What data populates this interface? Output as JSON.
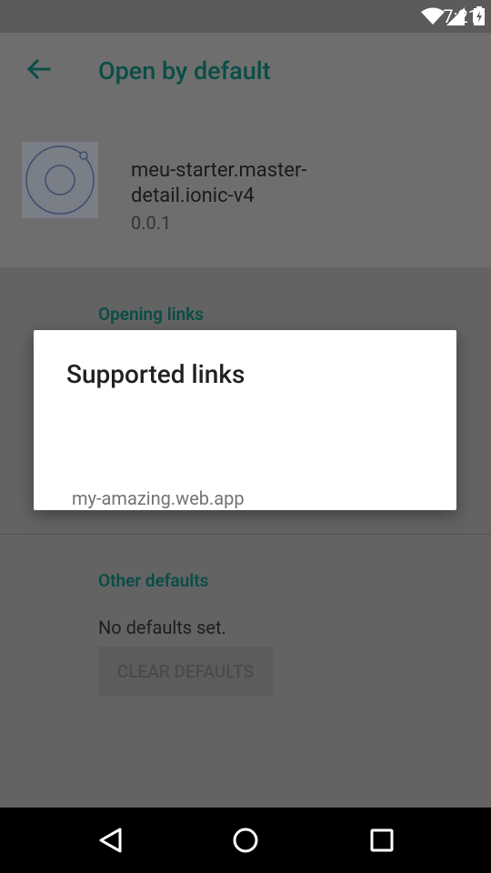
{
  "status_bar": {
    "time": "7:21"
  },
  "app_bar": {
    "title": "Open by default"
  },
  "app": {
    "name": "meu-starter.master-detail.ionic-v4",
    "version": "0.0.1"
  },
  "sections": {
    "opening_links": "Opening links",
    "other_defaults": "Other defaults",
    "no_defaults": "No defaults set.",
    "clear_defaults": "CLEAR DEFAULTS"
  },
  "dialog": {
    "title": "Supported links",
    "link": "my-amazing.web.app"
  },
  "colors": {
    "accent": "#0a4d47",
    "scrim": "#636363",
    "dialog_bg": "#ffffff"
  },
  "icons": {
    "back": "arrow-left-icon",
    "wifi": "wifi-icon",
    "signal": "signal-icon",
    "battery": "battery-charging-icon",
    "app": "ionic-app-icon",
    "nav_back": "triangle-back-icon",
    "nav_home": "circle-home-icon",
    "nav_recents": "square-recents-icon"
  }
}
